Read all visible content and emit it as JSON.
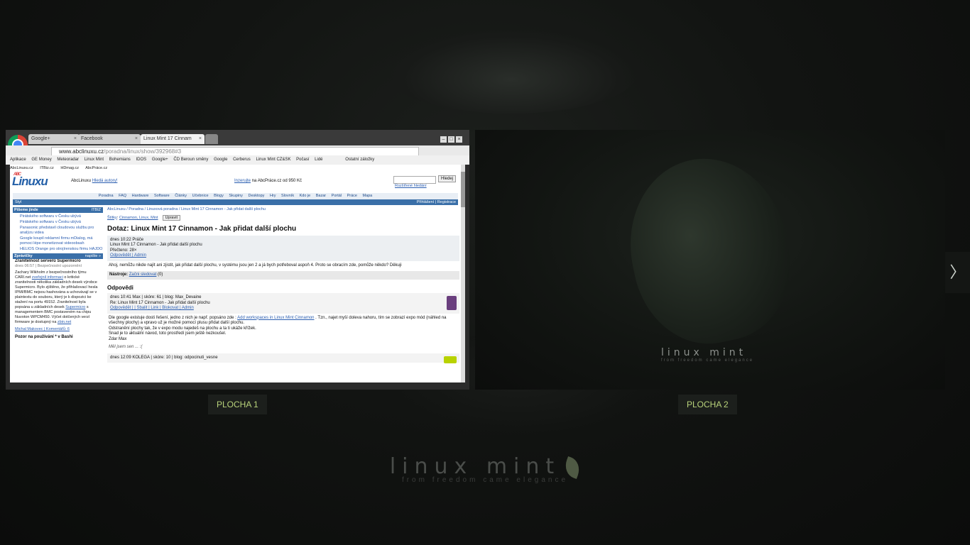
{
  "workspaces": [
    {
      "label": "PLOCHA 1"
    },
    {
      "label": "PLOCHA 2"
    }
  ],
  "next_arrow": "〉",
  "background": {
    "wordmark": "linux mint",
    "tagline": "from freedom came elegance"
  },
  "workspace2": {
    "wordmark": "linux mint",
    "tagline": "from freedom came elegance"
  },
  "browser": {
    "tabs": [
      {
        "label": "Google+"
      },
      {
        "label": "Facebook"
      },
      {
        "label": "Linux Mint 17 Cinnam"
      }
    ],
    "url_host": "www.abclinuxu.cz",
    "url_path": "/poradna/linux/show/392968#3",
    "bookmarks": [
      "Aplikace",
      "GE Money",
      "Meteoradar",
      "Linux Mint",
      "Bohemians",
      "IDOS",
      "Google+",
      "ČD Beroun směny",
      "Google",
      "Cerberus",
      "Linux Mint CZ&SK",
      "Počasí",
      "Lidé",
      "Ostatní záložky"
    ]
  },
  "site": {
    "top_links": [
      "AbcLinuxu.cz",
      "ITBiz.cz",
      "HDmag.cz",
      "AbcPráce.cz"
    ],
    "logo_top": "ABC",
    "logo": "Linuxu",
    "author_prefix": "AbcLinuxu",
    "author_link": "Hledá autory!",
    "ad_link": "Inzerujte",
    "ad_text": " na AbcPráce.cz od 950 Kč",
    "search_button": "Hledej",
    "advanced_search": "Rozšířené hledání",
    "nav": [
      "Poradna",
      "FAQ",
      "Hardware",
      "Software",
      "Články",
      "Učebnice",
      "Blogy",
      "Skupiny",
      "Desktopy",
      "Hry",
      "Slovník",
      "Kdo je",
      "Bazar",
      "Portál",
      "Práce",
      "Mapa"
    ],
    "bluebar_left": "Styl",
    "bluebar_right": "Přihlášení | Registrace"
  },
  "sidebar": {
    "section1": {
      "title": "Píšeme jinde",
      "badge": "ITBIZ",
      "items": [
        "Pirátského softwaru v Česku ubývá",
        "Pirátského softwaru v Česku ubývá",
        "Panasonic představil cloudovou službu pro analýzu videa",
        "Google koupil reklamní firmu mDialog, má pomoci lépe monetizovat videoobsah",
        "HELIOS Orange pro strojírenskou firmu HAJDO"
      ]
    },
    "section2": {
      "title": "Zprávičky",
      "action": "napište »"
    },
    "news1": {
      "title": "Zranitelnost serverů Supermicro",
      "meta": "dnes 06:57 | Bezpečnostní upozornění",
      "text_a": "Zachary Wikholm z bezpečnostního týmu CARI.net ",
      "link_a": "zveřejnil informaci",
      "text_b": " o kritické zranitelnosti několika základních desek výrobce Supermicro. Bylo zjištěno, že přihlašovací hesla IPMI/BMC nejsou hashována a uchovávají se v plaintextu do souboru, který je k dispozici ke stažení na portu 49152. Zranitelnost byla popsána u základních desek ",
      "link_b": "Supermicro",
      "text_c": " s managementem BMC postaveném na chipu Nuvoton WPCM450. Výčet dotčených verzí firmware je dostupný na ",
      "link_c": "zbin.net",
      "footer": "Michal Makovec | Komentářů: 6"
    },
    "news2": {
      "title": "Pozor na používání * v Bashi"
    }
  },
  "main": {
    "breadcrumb": "AbcLinuxu / Poradna / Linuxová poradna / Linux Mint 17 Cinnamon - Jak přidat další plochu",
    "tags_label": "Štítky",
    "tags_links": "Cinnamon, Linux, Mint",
    "edit_button": "Upravit",
    "title": "Dotaz: Linux Mint 17 Cinnamon - Jak přidat další plochu",
    "q_meta": "dnes 10:22 Práče",
    "q_subject": "Linux Mint 17 Cinnamon - Jak přidat další plochu",
    "q_read": "Přečteno: 28×",
    "q_links": "Odpovědět | Admin",
    "q_body": "Ahoj, nemůžu nikde najít ani zjistit, jak přidat další plochu, v systému jsou jen 2 a já bych potřeboval aspoň 4. Proto se obracím zde, pomůže někdo? Děkuji",
    "tools_label": "Nástroje:",
    "tools_link": "Začni sledovat",
    "tools_count": "(0)",
    "answers_title": "Odpovědi",
    "a1": {
      "meta": "dnes 10:41 Max | skóre: 61 | blog: Max_Devaine",
      "subject": "Re: Linux Mint 17 Cinnamon - Jak přidat další plochu",
      "links": "Odpovědět | | Sbalit | Link | Blokovat | Admin",
      "line1_a": "Dle google existuje dosti řešení, jedno z nich je např. popsáno zde : ",
      "line1_link": "Add workspaces in Linux Mint Cinnamon",
      "line1_b": " . Tzn., najet myší doleva nahoru, tím se zobrazí expo mód (náhled na všechny plochy) a vpravo už je možné pomocí plusu přidat další plochu.",
      "line2": "Odstranění plochy tak, že v expo modu najedeš na plochu a ta ti ukáže křížek.",
      "line3": "Snad je to aktuální návod, toto prostředí jsem ještě nezkoušel.",
      "line4": "Zdar Max",
      "sig": "Měl jsem sen ... :("
    },
    "a2": {
      "meta": "dnes 12:09 KOLEGA | skóre: 10 | blog: odpocinuti_vesne"
    }
  }
}
